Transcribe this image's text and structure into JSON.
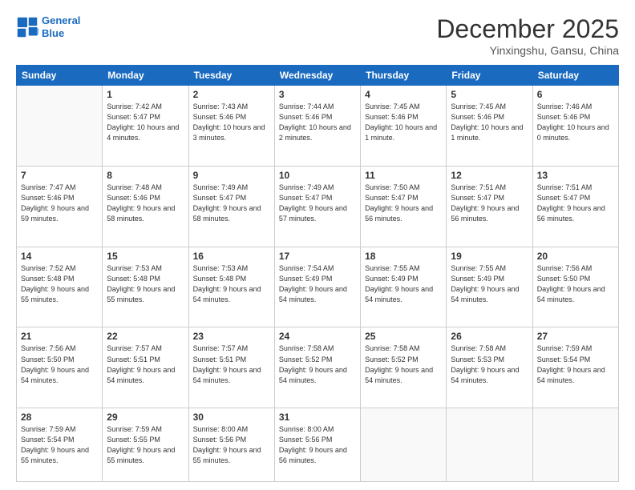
{
  "logo": {
    "line1": "General",
    "line2": "Blue"
  },
  "header": {
    "month": "December 2025",
    "location": "Yinxingshu, Gansu, China"
  },
  "weekdays": [
    "Sunday",
    "Monday",
    "Tuesday",
    "Wednesday",
    "Thursday",
    "Friday",
    "Saturday"
  ],
  "weeks": [
    [
      {
        "day": "",
        "sunrise": "",
        "sunset": "",
        "daylight": ""
      },
      {
        "day": "1",
        "sunrise": "Sunrise: 7:42 AM",
        "sunset": "Sunset: 5:47 PM",
        "daylight": "Daylight: 10 hours and 4 minutes."
      },
      {
        "day": "2",
        "sunrise": "Sunrise: 7:43 AM",
        "sunset": "Sunset: 5:46 PM",
        "daylight": "Daylight: 10 hours and 3 minutes."
      },
      {
        "day": "3",
        "sunrise": "Sunrise: 7:44 AM",
        "sunset": "Sunset: 5:46 PM",
        "daylight": "Daylight: 10 hours and 2 minutes."
      },
      {
        "day": "4",
        "sunrise": "Sunrise: 7:45 AM",
        "sunset": "Sunset: 5:46 PM",
        "daylight": "Daylight: 10 hours and 1 minute."
      },
      {
        "day": "5",
        "sunrise": "Sunrise: 7:45 AM",
        "sunset": "Sunset: 5:46 PM",
        "daylight": "Daylight: 10 hours and 1 minute."
      },
      {
        "day": "6",
        "sunrise": "Sunrise: 7:46 AM",
        "sunset": "Sunset: 5:46 PM",
        "daylight": "Daylight: 10 hours and 0 minutes."
      }
    ],
    [
      {
        "day": "7",
        "sunrise": "Sunrise: 7:47 AM",
        "sunset": "Sunset: 5:46 PM",
        "daylight": "Daylight: 9 hours and 59 minutes."
      },
      {
        "day": "8",
        "sunrise": "Sunrise: 7:48 AM",
        "sunset": "Sunset: 5:46 PM",
        "daylight": "Daylight: 9 hours and 58 minutes."
      },
      {
        "day": "9",
        "sunrise": "Sunrise: 7:49 AM",
        "sunset": "Sunset: 5:47 PM",
        "daylight": "Daylight: 9 hours and 58 minutes."
      },
      {
        "day": "10",
        "sunrise": "Sunrise: 7:49 AM",
        "sunset": "Sunset: 5:47 PM",
        "daylight": "Daylight: 9 hours and 57 minutes."
      },
      {
        "day": "11",
        "sunrise": "Sunrise: 7:50 AM",
        "sunset": "Sunset: 5:47 PM",
        "daylight": "Daylight: 9 hours and 56 minutes."
      },
      {
        "day": "12",
        "sunrise": "Sunrise: 7:51 AM",
        "sunset": "Sunset: 5:47 PM",
        "daylight": "Daylight: 9 hours and 56 minutes."
      },
      {
        "day": "13",
        "sunrise": "Sunrise: 7:51 AM",
        "sunset": "Sunset: 5:47 PM",
        "daylight": "Daylight: 9 hours and 56 minutes."
      }
    ],
    [
      {
        "day": "14",
        "sunrise": "Sunrise: 7:52 AM",
        "sunset": "Sunset: 5:48 PM",
        "daylight": "Daylight: 9 hours and 55 minutes."
      },
      {
        "day": "15",
        "sunrise": "Sunrise: 7:53 AM",
        "sunset": "Sunset: 5:48 PM",
        "daylight": "Daylight: 9 hours and 55 minutes."
      },
      {
        "day": "16",
        "sunrise": "Sunrise: 7:53 AM",
        "sunset": "Sunset: 5:48 PM",
        "daylight": "Daylight: 9 hours and 54 minutes."
      },
      {
        "day": "17",
        "sunrise": "Sunrise: 7:54 AM",
        "sunset": "Sunset: 5:49 PM",
        "daylight": "Daylight: 9 hours and 54 minutes."
      },
      {
        "day": "18",
        "sunrise": "Sunrise: 7:55 AM",
        "sunset": "Sunset: 5:49 PM",
        "daylight": "Daylight: 9 hours and 54 minutes."
      },
      {
        "day": "19",
        "sunrise": "Sunrise: 7:55 AM",
        "sunset": "Sunset: 5:49 PM",
        "daylight": "Daylight: 9 hours and 54 minutes."
      },
      {
        "day": "20",
        "sunrise": "Sunrise: 7:56 AM",
        "sunset": "Sunset: 5:50 PM",
        "daylight": "Daylight: 9 hours and 54 minutes."
      }
    ],
    [
      {
        "day": "21",
        "sunrise": "Sunrise: 7:56 AM",
        "sunset": "Sunset: 5:50 PM",
        "daylight": "Daylight: 9 hours and 54 minutes."
      },
      {
        "day": "22",
        "sunrise": "Sunrise: 7:57 AM",
        "sunset": "Sunset: 5:51 PM",
        "daylight": "Daylight: 9 hours and 54 minutes."
      },
      {
        "day": "23",
        "sunrise": "Sunrise: 7:57 AM",
        "sunset": "Sunset: 5:51 PM",
        "daylight": "Daylight: 9 hours and 54 minutes."
      },
      {
        "day": "24",
        "sunrise": "Sunrise: 7:58 AM",
        "sunset": "Sunset: 5:52 PM",
        "daylight": "Daylight: 9 hours and 54 minutes."
      },
      {
        "day": "25",
        "sunrise": "Sunrise: 7:58 AM",
        "sunset": "Sunset: 5:52 PM",
        "daylight": "Daylight: 9 hours and 54 minutes."
      },
      {
        "day": "26",
        "sunrise": "Sunrise: 7:58 AM",
        "sunset": "Sunset: 5:53 PM",
        "daylight": "Daylight: 9 hours and 54 minutes."
      },
      {
        "day": "27",
        "sunrise": "Sunrise: 7:59 AM",
        "sunset": "Sunset: 5:54 PM",
        "daylight": "Daylight: 9 hours and 54 minutes."
      }
    ],
    [
      {
        "day": "28",
        "sunrise": "Sunrise: 7:59 AM",
        "sunset": "Sunset: 5:54 PM",
        "daylight": "Daylight: 9 hours and 55 minutes."
      },
      {
        "day": "29",
        "sunrise": "Sunrise: 7:59 AM",
        "sunset": "Sunset: 5:55 PM",
        "daylight": "Daylight: 9 hours and 55 minutes."
      },
      {
        "day": "30",
        "sunrise": "Sunrise: 8:00 AM",
        "sunset": "Sunset: 5:56 PM",
        "daylight": "Daylight: 9 hours and 55 minutes."
      },
      {
        "day": "31",
        "sunrise": "Sunrise: 8:00 AM",
        "sunset": "Sunset: 5:56 PM",
        "daylight": "Daylight: 9 hours and 56 minutes."
      },
      {
        "day": "",
        "sunrise": "",
        "sunset": "",
        "daylight": ""
      },
      {
        "day": "",
        "sunrise": "",
        "sunset": "",
        "daylight": ""
      },
      {
        "day": "",
        "sunrise": "",
        "sunset": "",
        "daylight": ""
      }
    ]
  ]
}
